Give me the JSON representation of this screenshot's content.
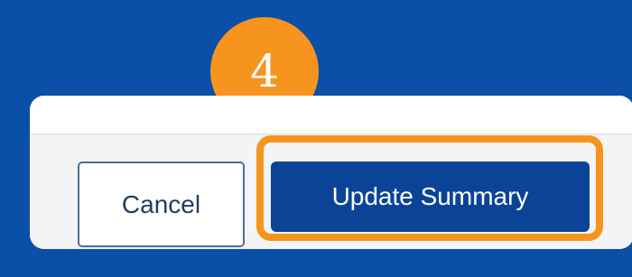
{
  "step_badge": {
    "number": "4",
    "color": "#f7941d"
  },
  "footer": {
    "cancel_label": "Cancel",
    "primary_label": "Update Summary"
  },
  "colors": {
    "page_background": "#0b4fa8",
    "primary_button": "#0b4496",
    "highlight": "#f7941d",
    "cancel_border": "#4d6f99",
    "cancel_text": "#1f3d66"
  }
}
